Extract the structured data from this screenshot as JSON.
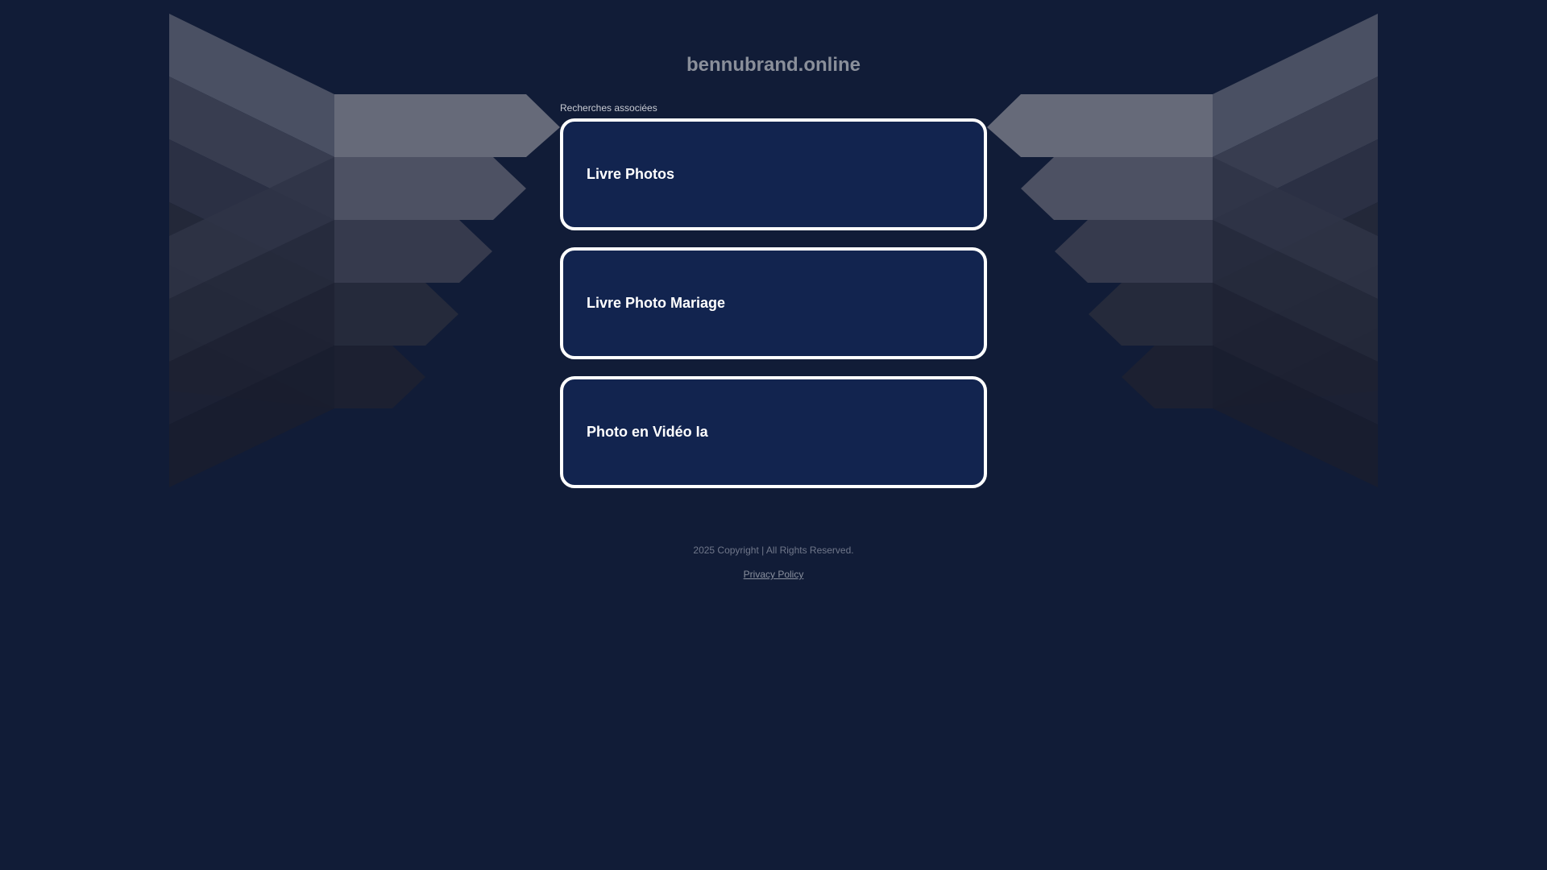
{
  "header": {
    "domain": "bennubrand.online"
  },
  "related": {
    "label": "Recherches associées",
    "links": [
      {
        "label": "Livre Photos"
      },
      {
        "label": "Livre Photo Mariage"
      },
      {
        "label": "Photo en Vidéo Ia"
      }
    ]
  },
  "footer": {
    "copyright": "2025 Copyright | All Rights Reserved.",
    "privacy_label": "Privacy Policy"
  },
  "colors": {
    "background": "#111c37",
    "card_background": "#12244f",
    "card_border": "#ffffff"
  }
}
